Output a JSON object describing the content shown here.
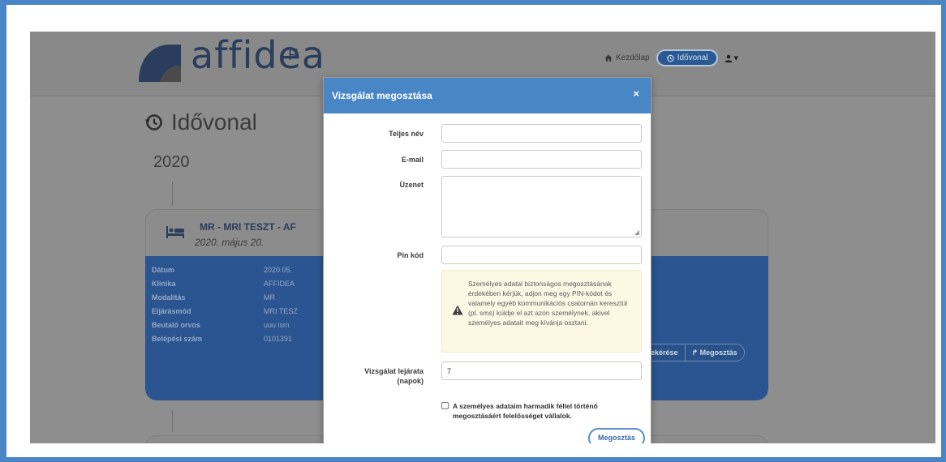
{
  "header": {
    "logo_text": "affidea",
    "logo_suffix": "F",
    "nav": {
      "home_label": "Kezdőlap",
      "timeline_label": "Idővonal",
      "user_caret": "▾"
    }
  },
  "page": {
    "title": "Idővonal",
    "year": "2020"
  },
  "card": {
    "title": "MR - MRI TESZT - AF",
    "date": "2020. május 20.",
    "rows": [
      {
        "key": "Dátum",
        "value": "2020.05."
      },
      {
        "key": "Klinika",
        "value": "AFFIDEA"
      },
      {
        "key": "Modalitás",
        "value": "MR"
      },
      {
        "key": "Eljárásmód",
        "value": "MRI TESZ"
      },
      {
        "key": "Beutaló orvos",
        "value": "uuu ism"
      },
      {
        "key": "Belépési szám",
        "value": "0101391"
      }
    ],
    "actions": {
      "images_label": "Képek lekérése",
      "share_label": "↱ Megosztás"
    }
  },
  "modal": {
    "title": "Vizsgálat megosztása",
    "close": "×",
    "fields": {
      "full_name_label": "Teljes név",
      "full_name_value": "",
      "email_label": "E-mail",
      "email_value": "",
      "message_label": "Üzenet",
      "message_value": "",
      "pin_label": "Pin kód",
      "pin_value": "",
      "expiry_label_line1": "Vizsgálat lejárata",
      "expiry_label_line2": "(napok)",
      "expiry_value": "7"
    },
    "warning_text": "Személyes adatai biztonságos megosztásának érdekében kérjük, adjon meg egy PIN-kódot és valamely egyéb kommunikációs csatornán keresztül (pl. sms) küldje el azt azon személynek, akivel személyes adatait meg kívánja osztani.",
    "consent_text": "A személyes adataim harmadik féllel történő megosztásáért felelősséget vállalok.",
    "consent_checked": false,
    "submit_label": "Megosztás"
  }
}
